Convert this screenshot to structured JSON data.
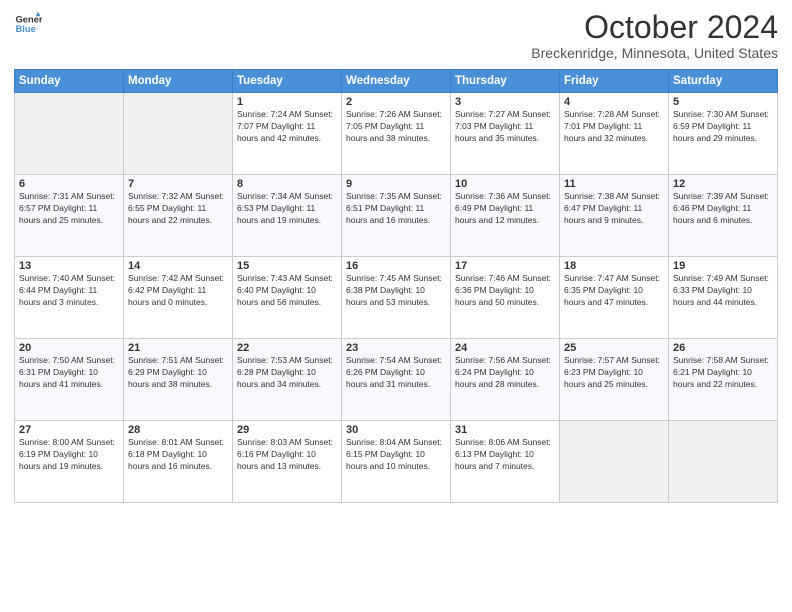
{
  "header": {
    "logo_line1": "General",
    "logo_line2": "Blue",
    "month_title": "October 2024",
    "location": "Breckenridge, Minnesota, United States"
  },
  "days_of_week": [
    "Sunday",
    "Monday",
    "Tuesday",
    "Wednesday",
    "Thursday",
    "Friday",
    "Saturday"
  ],
  "weeks": [
    [
      {
        "day": "",
        "info": ""
      },
      {
        "day": "",
        "info": ""
      },
      {
        "day": "1",
        "info": "Sunrise: 7:24 AM\nSunset: 7:07 PM\nDaylight: 11 hours and 42 minutes."
      },
      {
        "day": "2",
        "info": "Sunrise: 7:26 AM\nSunset: 7:05 PM\nDaylight: 11 hours and 38 minutes."
      },
      {
        "day": "3",
        "info": "Sunrise: 7:27 AM\nSunset: 7:03 PM\nDaylight: 11 hours and 35 minutes."
      },
      {
        "day": "4",
        "info": "Sunrise: 7:28 AM\nSunset: 7:01 PM\nDaylight: 11 hours and 32 minutes."
      },
      {
        "day": "5",
        "info": "Sunrise: 7:30 AM\nSunset: 6:59 PM\nDaylight: 11 hours and 29 minutes."
      }
    ],
    [
      {
        "day": "6",
        "info": "Sunrise: 7:31 AM\nSunset: 6:57 PM\nDaylight: 11 hours and 25 minutes."
      },
      {
        "day": "7",
        "info": "Sunrise: 7:32 AM\nSunset: 6:55 PM\nDaylight: 11 hours and 22 minutes."
      },
      {
        "day": "8",
        "info": "Sunrise: 7:34 AM\nSunset: 6:53 PM\nDaylight: 11 hours and 19 minutes."
      },
      {
        "day": "9",
        "info": "Sunrise: 7:35 AM\nSunset: 6:51 PM\nDaylight: 11 hours and 16 minutes."
      },
      {
        "day": "10",
        "info": "Sunrise: 7:36 AM\nSunset: 6:49 PM\nDaylight: 11 hours and 12 minutes."
      },
      {
        "day": "11",
        "info": "Sunrise: 7:38 AM\nSunset: 6:47 PM\nDaylight: 11 hours and 9 minutes."
      },
      {
        "day": "12",
        "info": "Sunrise: 7:39 AM\nSunset: 6:46 PM\nDaylight: 11 hours and 6 minutes."
      }
    ],
    [
      {
        "day": "13",
        "info": "Sunrise: 7:40 AM\nSunset: 6:44 PM\nDaylight: 11 hours and 3 minutes."
      },
      {
        "day": "14",
        "info": "Sunrise: 7:42 AM\nSunset: 6:42 PM\nDaylight: 11 hours and 0 minutes."
      },
      {
        "day": "15",
        "info": "Sunrise: 7:43 AM\nSunset: 6:40 PM\nDaylight: 10 hours and 56 minutes."
      },
      {
        "day": "16",
        "info": "Sunrise: 7:45 AM\nSunset: 6:38 PM\nDaylight: 10 hours and 53 minutes."
      },
      {
        "day": "17",
        "info": "Sunrise: 7:46 AM\nSunset: 6:36 PM\nDaylight: 10 hours and 50 minutes."
      },
      {
        "day": "18",
        "info": "Sunrise: 7:47 AM\nSunset: 6:35 PM\nDaylight: 10 hours and 47 minutes."
      },
      {
        "day": "19",
        "info": "Sunrise: 7:49 AM\nSunset: 6:33 PM\nDaylight: 10 hours and 44 minutes."
      }
    ],
    [
      {
        "day": "20",
        "info": "Sunrise: 7:50 AM\nSunset: 6:31 PM\nDaylight: 10 hours and 41 minutes."
      },
      {
        "day": "21",
        "info": "Sunrise: 7:51 AM\nSunset: 6:29 PM\nDaylight: 10 hours and 38 minutes."
      },
      {
        "day": "22",
        "info": "Sunrise: 7:53 AM\nSunset: 6:28 PM\nDaylight: 10 hours and 34 minutes."
      },
      {
        "day": "23",
        "info": "Sunrise: 7:54 AM\nSunset: 6:26 PM\nDaylight: 10 hours and 31 minutes."
      },
      {
        "day": "24",
        "info": "Sunrise: 7:56 AM\nSunset: 6:24 PM\nDaylight: 10 hours and 28 minutes."
      },
      {
        "day": "25",
        "info": "Sunrise: 7:57 AM\nSunset: 6:23 PM\nDaylight: 10 hours and 25 minutes."
      },
      {
        "day": "26",
        "info": "Sunrise: 7:58 AM\nSunset: 6:21 PM\nDaylight: 10 hours and 22 minutes."
      }
    ],
    [
      {
        "day": "27",
        "info": "Sunrise: 8:00 AM\nSunset: 6:19 PM\nDaylight: 10 hours and 19 minutes."
      },
      {
        "day": "28",
        "info": "Sunrise: 8:01 AM\nSunset: 6:18 PM\nDaylight: 10 hours and 16 minutes."
      },
      {
        "day": "29",
        "info": "Sunrise: 8:03 AM\nSunset: 6:16 PM\nDaylight: 10 hours and 13 minutes."
      },
      {
        "day": "30",
        "info": "Sunrise: 8:04 AM\nSunset: 6:15 PM\nDaylight: 10 hours and 10 minutes."
      },
      {
        "day": "31",
        "info": "Sunrise: 8:06 AM\nSunset: 6:13 PM\nDaylight: 10 hours and 7 minutes."
      },
      {
        "day": "",
        "info": ""
      },
      {
        "day": "",
        "info": ""
      }
    ]
  ]
}
